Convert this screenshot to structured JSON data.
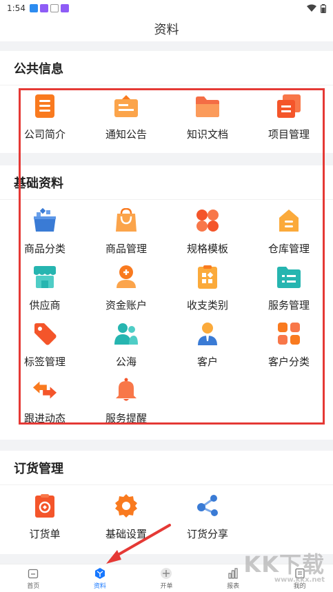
{
  "status_bar": {
    "time": "1:54"
  },
  "header": {
    "title": "资料"
  },
  "sections": [
    {
      "title": "公共信息",
      "items": [
        {
          "label": "公司简介",
          "icon": "document-list-icon"
        },
        {
          "label": "通知公告",
          "icon": "notice-board-icon"
        },
        {
          "label": "知识文档",
          "icon": "folder-icon"
        },
        {
          "label": "项目管理",
          "icon": "stacked-cards-icon"
        }
      ]
    },
    {
      "title": "基础资料",
      "items": [
        {
          "label": "商品分类",
          "icon": "product-box-icon"
        },
        {
          "label": "商品管理",
          "icon": "shopping-bag-icon"
        },
        {
          "label": "规格模板",
          "icon": "four-petal-icon"
        },
        {
          "label": "仓库管理",
          "icon": "warehouse-icon"
        },
        {
          "label": "供应商",
          "icon": "store-icon"
        },
        {
          "label": "资金账户",
          "icon": "user-coin-icon"
        },
        {
          "label": "收支类别",
          "icon": "category-clipboard-icon"
        },
        {
          "label": "服务管理",
          "icon": "service-card-icon"
        },
        {
          "label": "标签管理",
          "icon": "tag-icon"
        },
        {
          "label": "公海",
          "icon": "group-users-icon"
        },
        {
          "label": "客户",
          "icon": "customer-icon"
        },
        {
          "label": "客户分类",
          "icon": "grid-squares-icon"
        },
        {
          "label": "跟进动态",
          "icon": "swap-arrows-icon"
        },
        {
          "label": "服务提醒",
          "icon": "bell-icon"
        }
      ]
    },
    {
      "title": "订货管理",
      "items": [
        {
          "label": "订货单",
          "icon": "order-clipboard-icon"
        },
        {
          "label": "基础设置",
          "icon": "settings-gear-icon"
        },
        {
          "label": "订货分享",
          "icon": "share-icon"
        }
      ]
    }
  ],
  "tabbar": [
    {
      "label": "首页",
      "icon": "home-icon"
    },
    {
      "label": "资料",
      "icon": "cube-icon",
      "active": true
    },
    {
      "label": "开单",
      "icon": "plus-circle-icon"
    },
    {
      "label": "报表",
      "icon": "bar-chart-icon"
    },
    {
      "label": "我的",
      "icon": "profile-doc-icon"
    }
  ],
  "watermark": {
    "brand": "KK下载",
    "url": "www.kkx.net"
  },
  "colors": {
    "orange": "#f97a1f",
    "teal": "#26b5b0",
    "blue": "#3a7bd5",
    "accent": "#1677ff",
    "annotation_red": "#e53935"
  }
}
